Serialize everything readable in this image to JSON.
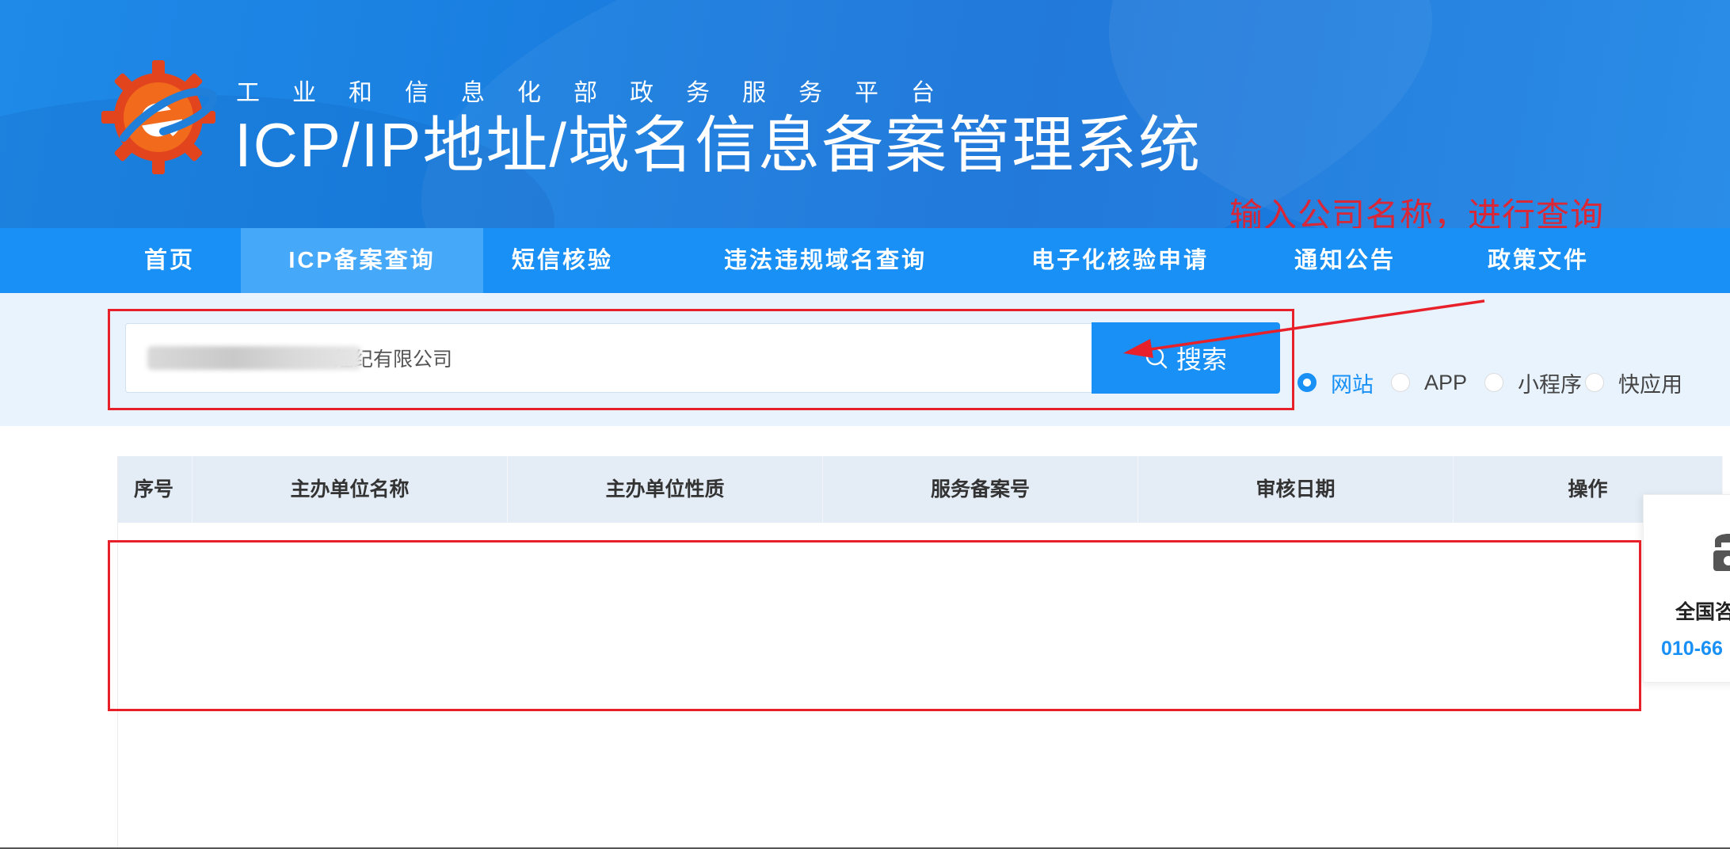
{
  "header": {
    "subtitle_chars": [
      "工",
      "业",
      "和",
      "信",
      "息",
      "化",
      "部",
      "政",
      "务",
      "服",
      "务",
      "平",
      "台"
    ],
    "title": "ICP/IP地址/域名信息备案管理系统"
  },
  "nav": {
    "items": [
      {
        "label": "首页",
        "active": false
      },
      {
        "label": "ICP备案查询",
        "active": true
      },
      {
        "label": "短信核验",
        "active": false
      },
      {
        "label": "违法违规域名查询",
        "active": false
      },
      {
        "label": "电子化核验申请",
        "active": false
      },
      {
        "label": "通知公告",
        "active": false
      },
      {
        "label": "政策文件",
        "active": false
      }
    ]
  },
  "search": {
    "input_value": "经纪有限公司",
    "input_value_obscured": true,
    "button_label": "搜索",
    "button_icon": "search-icon",
    "radio_options": [
      {
        "label": "网站",
        "checked": true
      },
      {
        "label": "APP",
        "checked": false
      },
      {
        "label": "小程序",
        "checked": false
      },
      {
        "label": "快应用",
        "checked": false
      }
    ]
  },
  "annotation": {
    "text": "输入公司名称，进行查询",
    "color": "#e8202a"
  },
  "table": {
    "columns": [
      "序号",
      "主办单位名称",
      "主办单位性质",
      "服务备案号",
      "审核日期",
      "操作"
    ],
    "rows": []
  },
  "contact": {
    "icon": "phone-icon",
    "label": "全国咨",
    "phone": "010-66"
  },
  "colors": {
    "primary": "#1890f5",
    "nav_active": "#46a8f8",
    "header_bg": "#1a7fe0",
    "search_band": "#e9f3fd",
    "table_header": "#e4ecf5",
    "annotation_red": "#e8202a"
  }
}
